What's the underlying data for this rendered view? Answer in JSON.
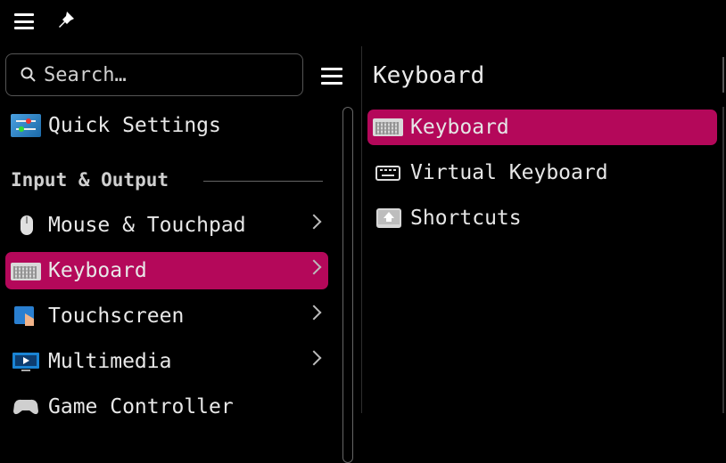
{
  "search": {
    "placeholder": "Search…"
  },
  "sidebar": {
    "quick_settings": "Quick Settings",
    "section_title": "Input & Output",
    "items": [
      {
        "label": "Mouse & Touchpad",
        "icon": "mouse-icon"
      },
      {
        "label": "Keyboard",
        "icon": "keyboard-icon",
        "active": true
      },
      {
        "label": "Touchscreen",
        "icon": "touchscreen-icon"
      },
      {
        "label": "Multimedia",
        "icon": "multimedia-icon"
      },
      {
        "label": "Game Controller",
        "icon": "game-controller-icon"
      }
    ]
  },
  "content": {
    "title": "Keyboard",
    "items": [
      {
        "label": "Keyboard",
        "icon": "keyboard-icon",
        "active": true
      },
      {
        "label": "Virtual Keyboard",
        "icon": "virtual-keyboard-icon"
      },
      {
        "label": "Shortcuts",
        "icon": "shortcuts-icon"
      }
    ]
  },
  "colors": {
    "accent": "#b4085a",
    "background": "#000000"
  }
}
